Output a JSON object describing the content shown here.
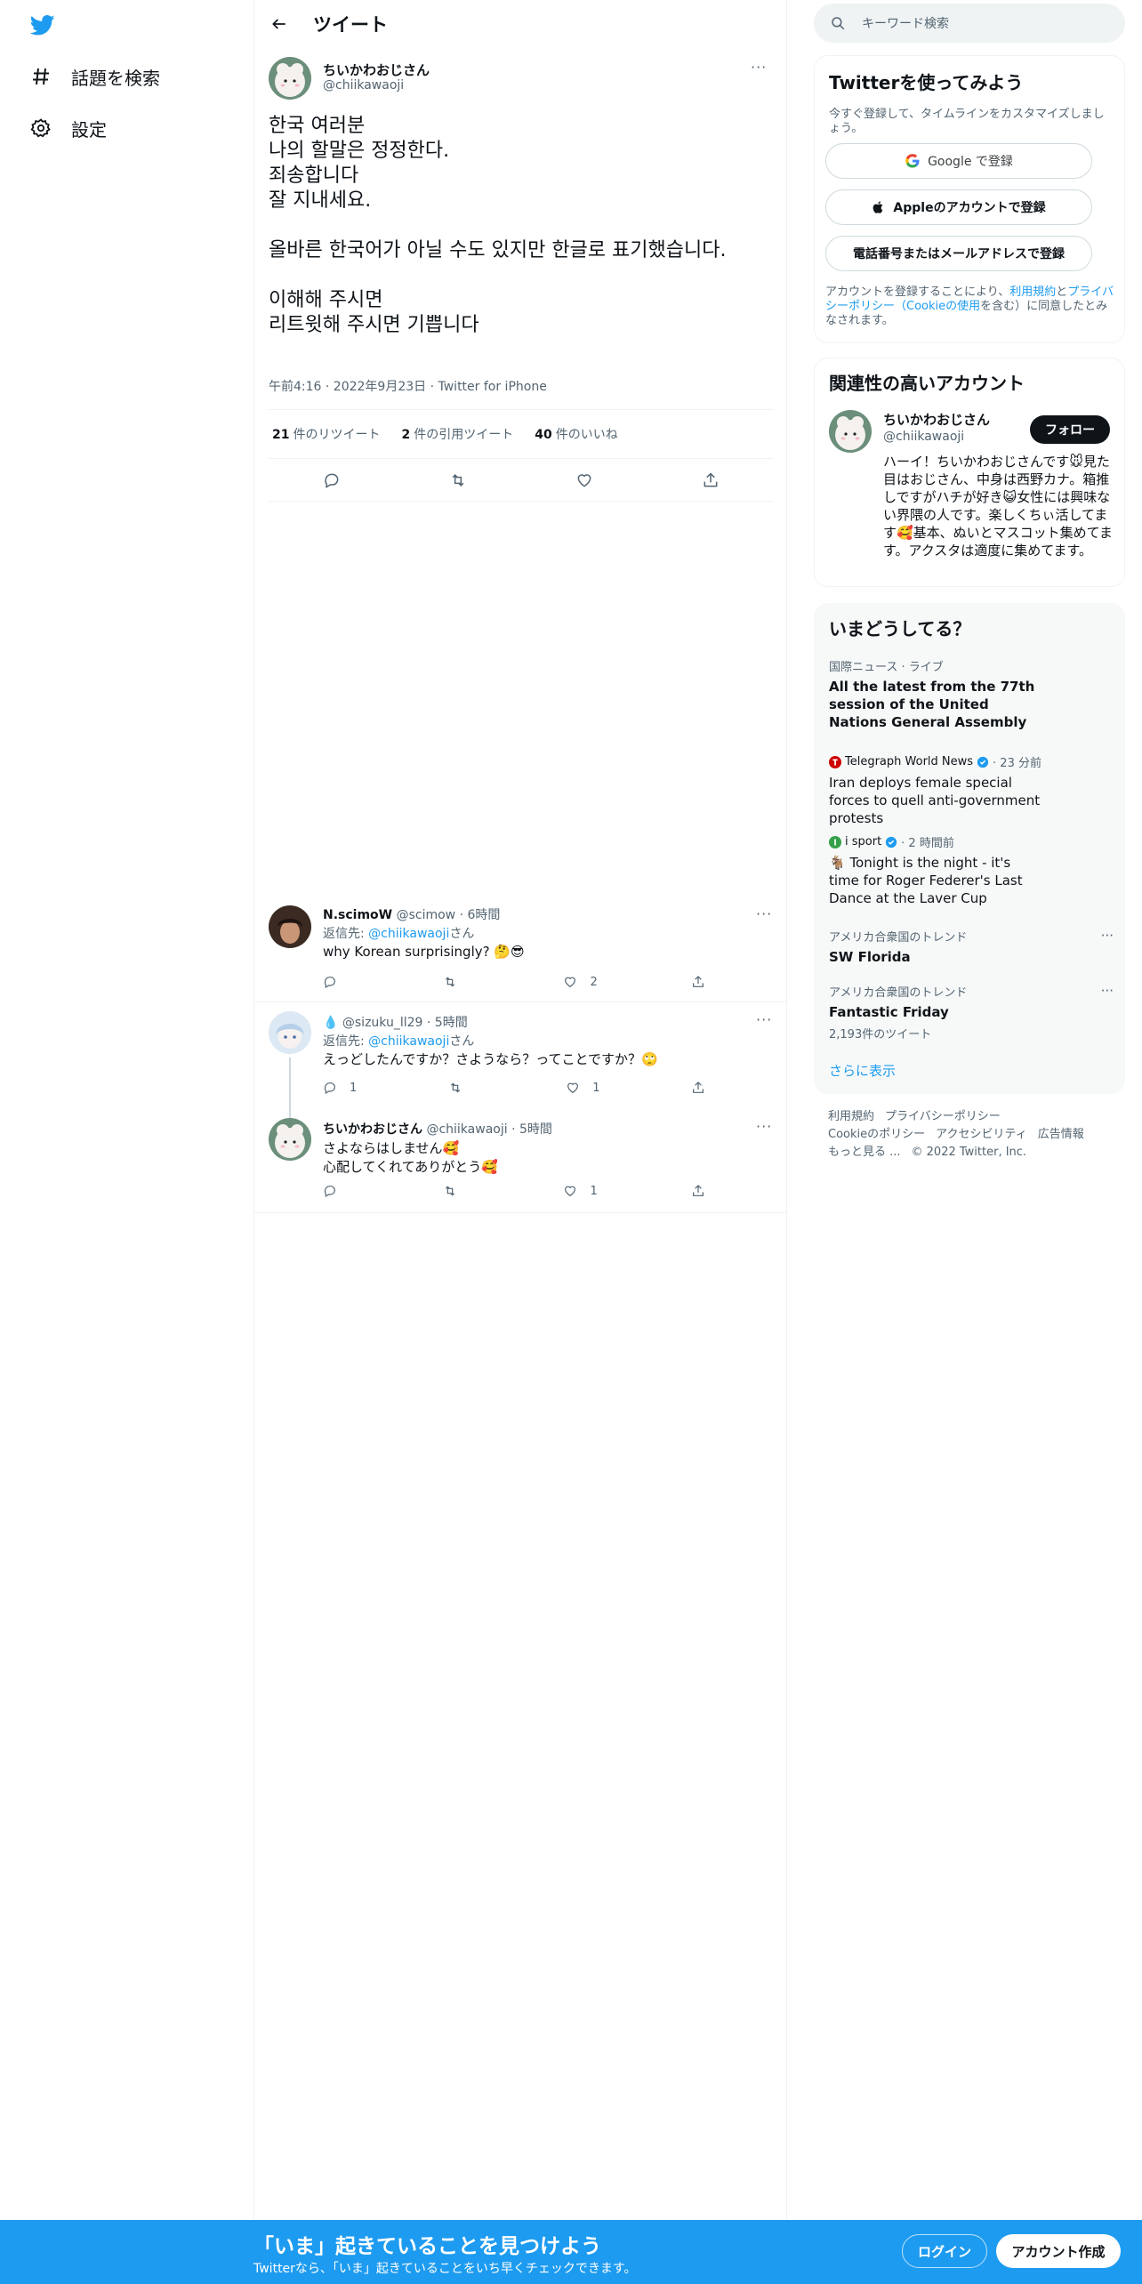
{
  "colors": {
    "brand": "#1d9bf0",
    "text": "#0f1419",
    "muted": "#536471"
  },
  "nav": {
    "logo_icon": "twitter-bird-icon",
    "items": [
      {
        "label": "話題を検索",
        "icon": "hashtag-icon"
      },
      {
        "label": "設定",
        "icon": "gear-icon"
      }
    ]
  },
  "header": {
    "title": "ツイート"
  },
  "tweet": {
    "name": "ちいかわおじさん",
    "handle": "@chiikawaoji",
    "body": "한국 여러분\n나의 할말은 정정한다.\n죄송합니다\n잘 지내세요.\n\n올바른 한국어가 아닐 수도 있지만 한글로 표기했습니다.\n\n이해해 주시면\n리트윗해 주시면 기쁩니다",
    "time": "午前4:16 · 2022年9月23日 · Twitter for iPhone",
    "stats": [
      {
        "count": "21",
        "label": "件のリツイート"
      },
      {
        "count": "2",
        "label": "件の引用ツイート"
      },
      {
        "count": "40",
        "label": "件のいいね"
      }
    ]
  },
  "replies": [
    {
      "name": "N.scimoW",
      "handle": "@scimow",
      "time": "· 6時間",
      "reply_prefix": "返信先:",
      "reply_to": "@chiikawaoji",
      "reply_suffix": "さん",
      "text": "why Korean surprisingly? 🤔😎",
      "replies": "",
      "retweets": "",
      "likes": "2"
    },
    {
      "name": "💧",
      "handle": "@sizuku_ll29",
      "time": "· 5時間",
      "reply_prefix": "返信先:",
      "reply_to": "@chiikawaoji",
      "reply_suffix": "さん",
      "text": "えっどしたんですか？さようなら？ってことですか？🙄",
      "replies": "1",
      "retweets": "",
      "likes": "1"
    },
    {
      "name": "ちいかわおじさん",
      "handle": "@chiikawaoji",
      "time": "· 5時間",
      "text": "さよならはしません🥰\n心配してくれてありがとう🥰",
      "replies": "",
      "retweets": "",
      "likes": "1"
    }
  ],
  "search": {
    "placeholder": "キーワード検索"
  },
  "signup": {
    "title": "Twitterを使ってみよう",
    "subtitle": "今すぐ登録して、タイムラインをカスタマイズしましょう。",
    "google": "Google で登録",
    "apple": "Appleのアカウントで登録",
    "phone": "電話番号またはメールアドレスで登録",
    "terms_1": "アカウントを登録することにより、",
    "terms_link_1": "利用規約",
    "terms_2": "と",
    "terms_link_2": "プライバシーポリシー（Cookieの使用",
    "terms_3": "を含む）に同意したとみなされます。"
  },
  "related": {
    "title": "関連性の高いアカウント",
    "name": "ちいかわおじさん",
    "handle": "@chiikawaoji",
    "follow": "フォロー",
    "bio": "ハーイ！ちいかわおじさんです🐭見た目はおじさん、中身は西野カナ。箱推しですがハチが好き😺女性には興味ない界隈の人です。楽しくちぃ活してます🥰基本、ぬいとマスコット集めてます。アクスタは適度に集めてます。"
  },
  "trends": {
    "title": "いまどうしてる？",
    "items": [
      {
        "meta": "国際ニュース · ライブ",
        "title": "All the latest from the 77th session of the United Nations General Assembly"
      },
      {
        "source": "Telegraph World News",
        "time": "· 23 分前",
        "title": "Iran deploys female special forces to quell anti-government protests"
      },
      {
        "source": "i sport",
        "time": "· 2 時間前",
        "title": "🐐 Tonight is the night - it's time for Roger Federer's Last Dance at the Laver Cup"
      },
      {
        "meta": "アメリカ合衆国のトレンド",
        "title": "SW Florida"
      },
      {
        "meta": "アメリカ合衆国のトレンド",
        "title": "Fantastic Friday",
        "count": "2,193件のツイート"
      }
    ],
    "show_more": "さらに表示"
  },
  "footer": {
    "links": [
      "利用規約",
      "プライバシーポリシー",
      "Cookieのポリシー",
      "アクセシビリティ",
      "広告情報",
      "もっと見る ...",
      "© 2022 Twitter, Inc."
    ]
  },
  "bottom": {
    "title": "「いま」起きていることを見つけよう",
    "subtitle": "Twitterなら、「いま」起きていることをいち早くチェックできます。",
    "login": "ログイン",
    "signup": "アカウント作成"
  }
}
